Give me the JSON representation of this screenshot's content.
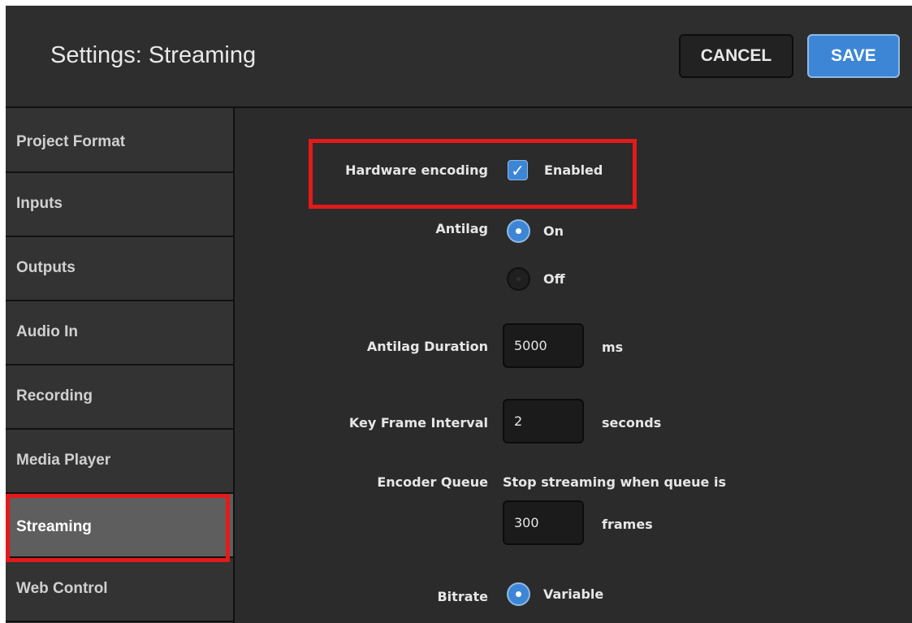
{
  "header": {
    "title": "Settings: Streaming",
    "cancel_label": "CANCEL",
    "save_label": "SAVE"
  },
  "sidebar": {
    "items": [
      {
        "label": "Project Format"
      },
      {
        "label": "Inputs"
      },
      {
        "label": "Outputs"
      },
      {
        "label": "Audio In"
      },
      {
        "label": "Recording"
      },
      {
        "label": "Media Player"
      },
      {
        "label": "Streaming",
        "active": true
      },
      {
        "label": "Web Control"
      }
    ]
  },
  "content": {
    "hardware_encoding": {
      "label": "Hardware encoding",
      "option": "Enabled",
      "checked": true
    },
    "antilag": {
      "label": "Antilag",
      "options": [
        "On",
        "Off"
      ],
      "selected": "On"
    },
    "antilag_duration": {
      "label": "Antilag Duration",
      "value": "5000",
      "unit": "ms"
    },
    "key_frame_interval": {
      "label": "Key Frame Interval",
      "value": "2",
      "unit": "seconds"
    },
    "encoder_queue": {
      "label": "Encoder Queue",
      "description": "Stop streaming when queue is",
      "value": "300",
      "unit": "frames"
    },
    "bitrate": {
      "label": "Bitrate",
      "option": "Variable",
      "selected": true
    }
  },
  "colors": {
    "accent": "#3d86d6",
    "highlight": "#e31a1a",
    "background": "#2b2b2b"
  }
}
